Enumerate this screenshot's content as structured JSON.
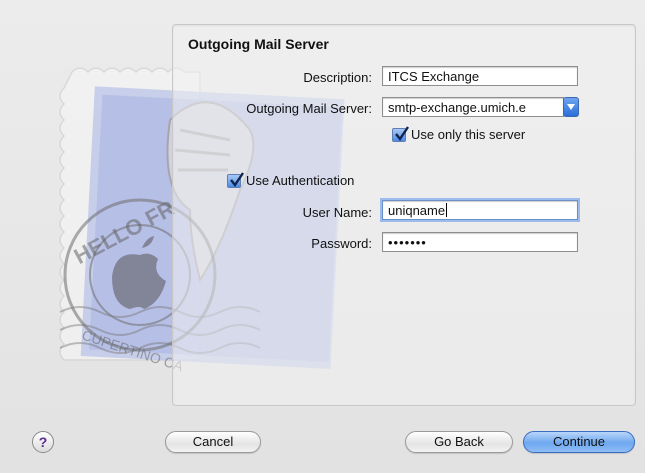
{
  "form": {
    "title": "Outgoing Mail Server",
    "description_label": "Description:",
    "description_value": "ITCS Exchange",
    "server_label": "Outgoing Mail Server:",
    "server_value": "smtp-exchange.umich.e",
    "use_only_label": "Use only this server",
    "use_auth_label": "Use Authentication",
    "username_label": "User Name:",
    "username_value": "uniqname",
    "password_label": "Password:",
    "password_value": "•••••••"
  },
  "stamp": {
    "postmark_top": "HELLO FR",
    "postmark_bottom": "CUPERTINO CA"
  },
  "footer": {
    "help_label": "?",
    "cancel_label": "Cancel",
    "go_back_label": "Go Back",
    "continue_label": "Continue"
  },
  "colors": {
    "accent": "#4c8ce6",
    "focus_ring": "#9bbcec"
  },
  "icons": {
    "help": "help-icon",
    "checkmark": "checkmark-icon",
    "popup": "chevron-down-icon"
  }
}
